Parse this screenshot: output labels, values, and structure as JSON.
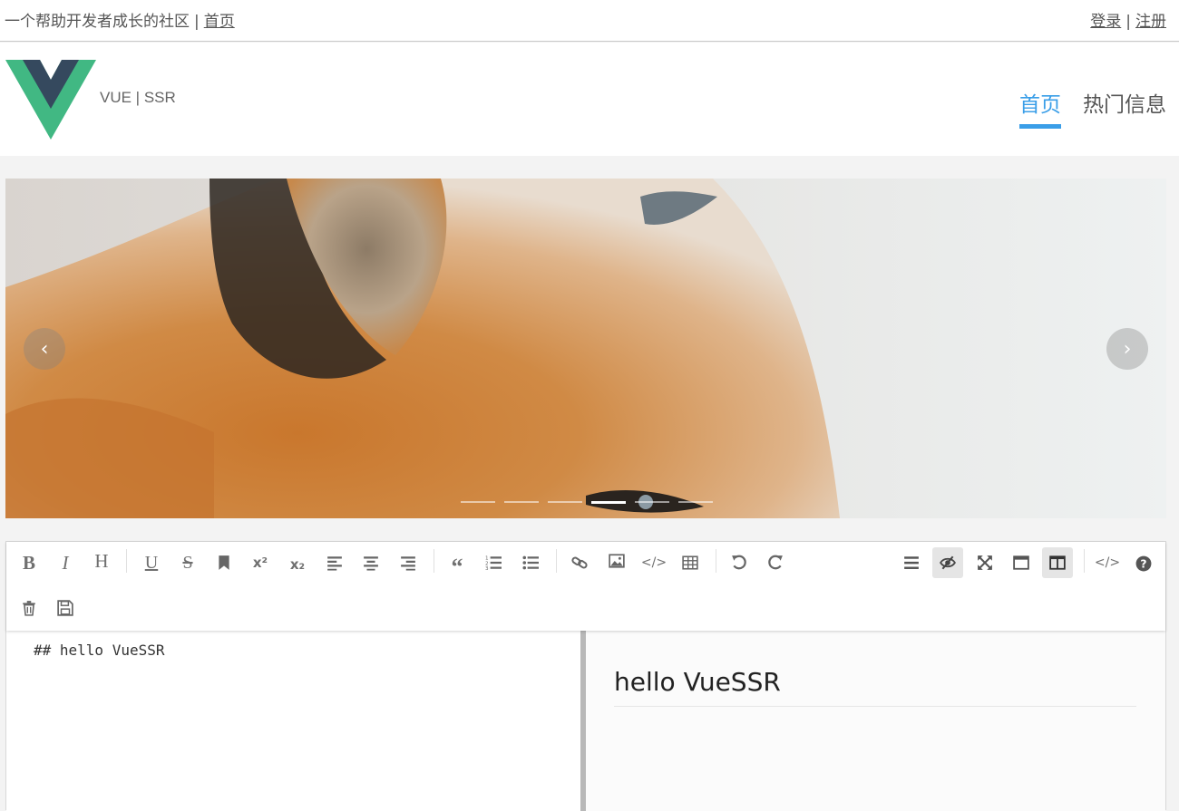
{
  "topbar": {
    "slogan": "一个帮助开发者成长的社区",
    "separator": "|",
    "home_link": "首页",
    "login": "登录",
    "register": "注册"
  },
  "header": {
    "brand": "VUE | SSR",
    "nav": [
      {
        "label": "首页",
        "active": true
      },
      {
        "label": "热门信息",
        "active": false
      }
    ]
  },
  "carousel": {
    "prev_icon": "chevron-left-icon",
    "next_icon": "chevron-right-icon",
    "prev_glyph": "‹",
    "next_glyph": "›",
    "slide_count": 6,
    "active_slide": 4
  },
  "editor": {
    "toolbar_row1": [
      "bold",
      "italic",
      "header",
      "underline",
      "strikethrough",
      "mark",
      "superscript",
      "subscript",
      "align-left",
      "align-center",
      "align-right",
      "quote",
      "ordered-list",
      "unordered-list",
      "link",
      "image",
      "code",
      "table",
      "undo",
      "redo"
    ],
    "toolbar_right": [
      "navigation",
      "preview",
      "fullscreen",
      "read-mode",
      "subfield",
      "html-code",
      "help"
    ],
    "toolbar_row2": [
      "trash",
      "save"
    ],
    "source": "## hello VueSSR",
    "preview_heading": "hello VueSSR"
  }
}
